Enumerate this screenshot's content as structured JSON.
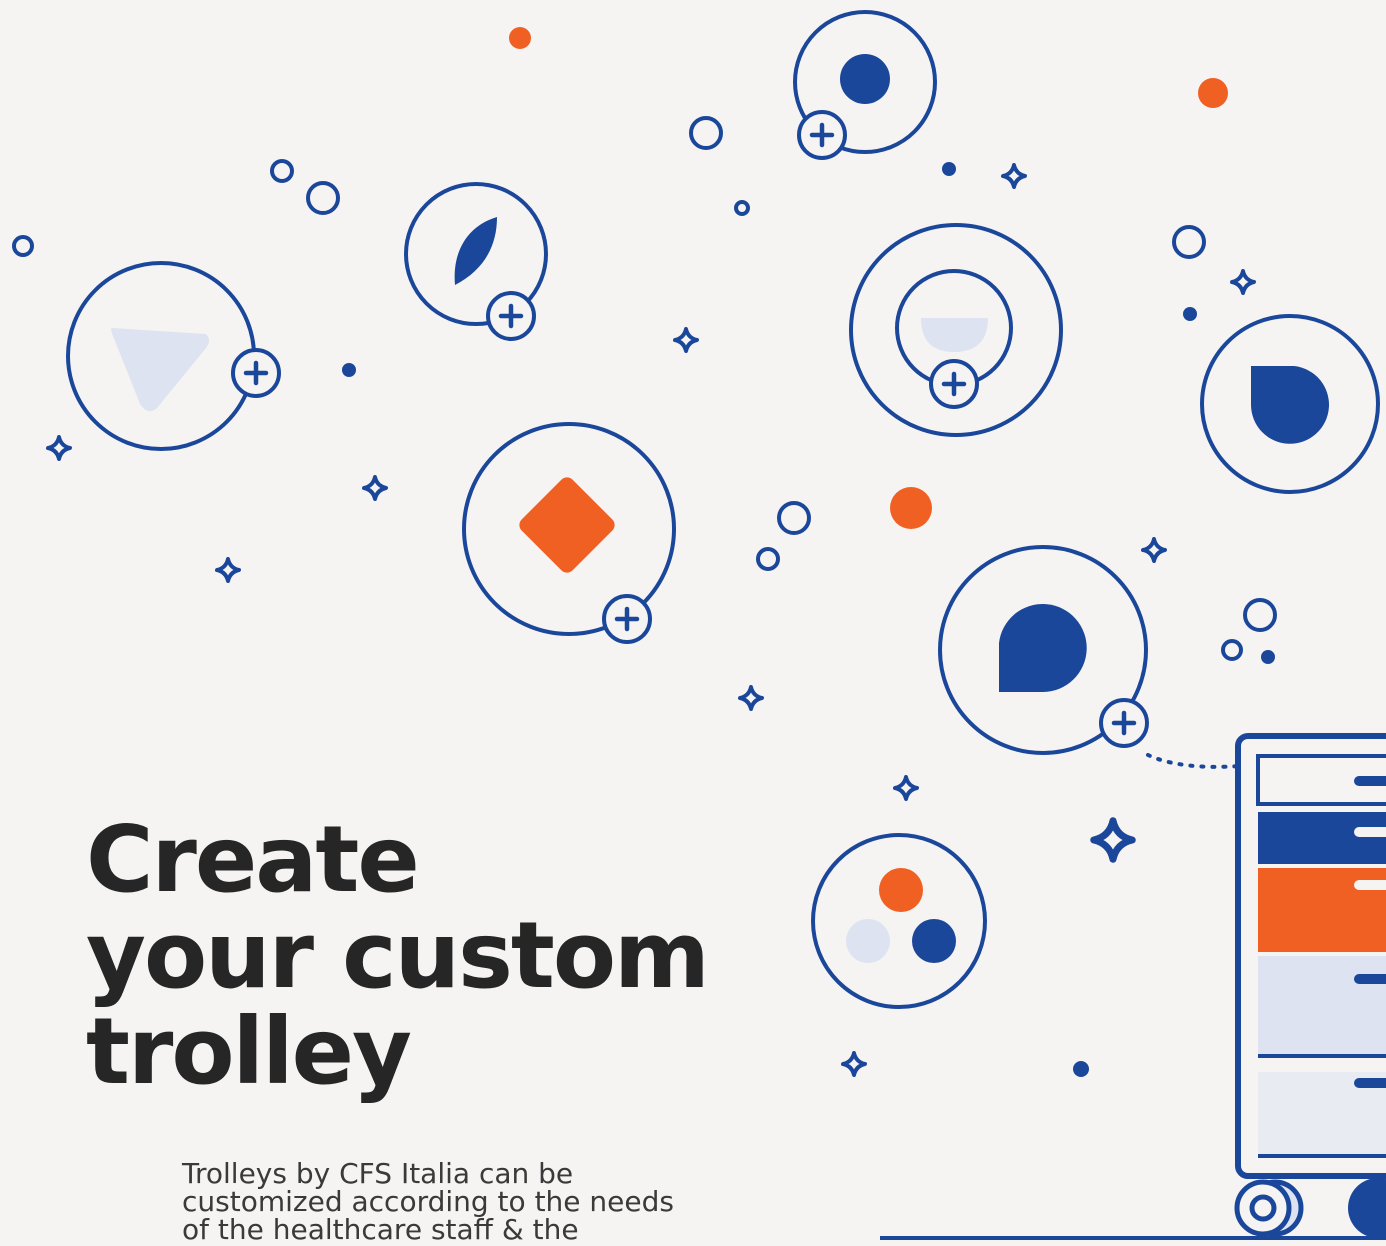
{
  "hero": {
    "headline_lines": [
      "Create",
      "your custom",
      "trolley"
    ],
    "body": "Trolleys by CFS Italia can be customized according to the needs of the healthcare staff & the"
  },
  "colors": {
    "background": "#f5f4f2",
    "brand_blue": "#1b479b",
    "accent_orange": "#f06022",
    "light_blue": "#dde3f0",
    "text": "#262626"
  },
  "icons": [
    "play-icon-circle",
    "leaf-icon-circle",
    "dot-icon-circle",
    "half-circle-icon-circle",
    "drop-icon-circle",
    "diamond-icon-circle",
    "speech-bubble-icon-circle",
    "three-dots-icon-circle",
    "add-icon",
    "sparkle-icon",
    "trolley-illustration"
  ]
}
